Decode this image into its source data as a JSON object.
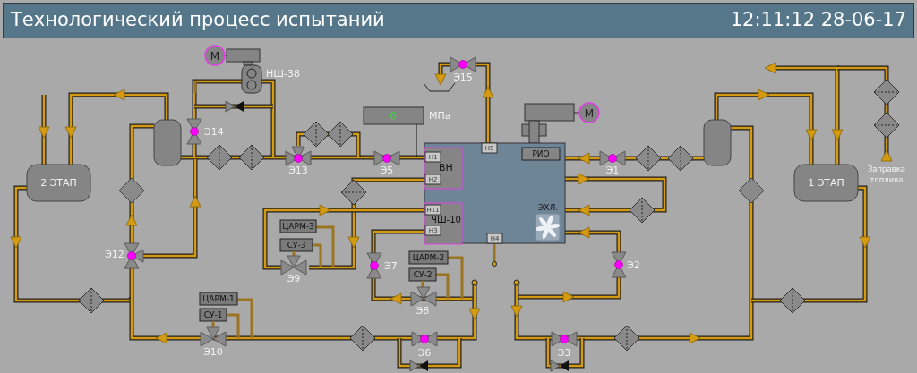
{
  "header": {
    "title": "Технологический процесс испытаний",
    "clock": "12:11:12 28-06-17"
  },
  "valves": [
    {
      "label": "Э15",
      "active": true
    },
    {
      "label": "Э14",
      "active": true
    },
    {
      "label": "Э13",
      "active": true
    },
    {
      "label": "Э5",
      "active": true
    },
    {
      "label": "Э1",
      "active": true
    },
    {
      "label": "Э12",
      "active": true
    },
    {
      "label": "Э9",
      "active": false
    },
    {
      "label": "Э7",
      "active": true
    },
    {
      "label": "Э8",
      "active": false
    },
    {
      "label": "Э2",
      "active": true
    },
    {
      "label": "Э10",
      "active": false
    },
    {
      "label": "Э6",
      "active": true
    },
    {
      "label": "Э3",
      "active": true
    }
  ],
  "tanks": [
    {
      "label": "2 ЭТАП"
    },
    {
      "label": "1 ЭТАП"
    }
  ],
  "controllers": [
    {
      "label": "ЦАРМ-3"
    },
    {
      "label": "СУ-3"
    },
    {
      "label": "ЦАРМ-2"
    },
    {
      "label": "СУ-2"
    },
    {
      "label": "ЦАРМ-1"
    },
    {
      "label": "СУ-1"
    }
  ],
  "pump": {
    "label": "НШ-38"
  },
  "motors": [
    {
      "label": "М"
    },
    {
      "label": "М"
    }
  ],
  "pressure": {
    "value": "0",
    "unit": "МПа"
  },
  "unit": {
    "ports": [
      "Н5",
      "Н1",
      "Н2",
      "Н11",
      "Н3",
      "Н4"
    ],
    "rio": "РИО",
    "sections": [
      "ВН",
      "ЧШ-10"
    ],
    "cooler": "ЭХЛ."
  },
  "refuel_label": [
    "Заправка",
    "топлива"
  ]
}
